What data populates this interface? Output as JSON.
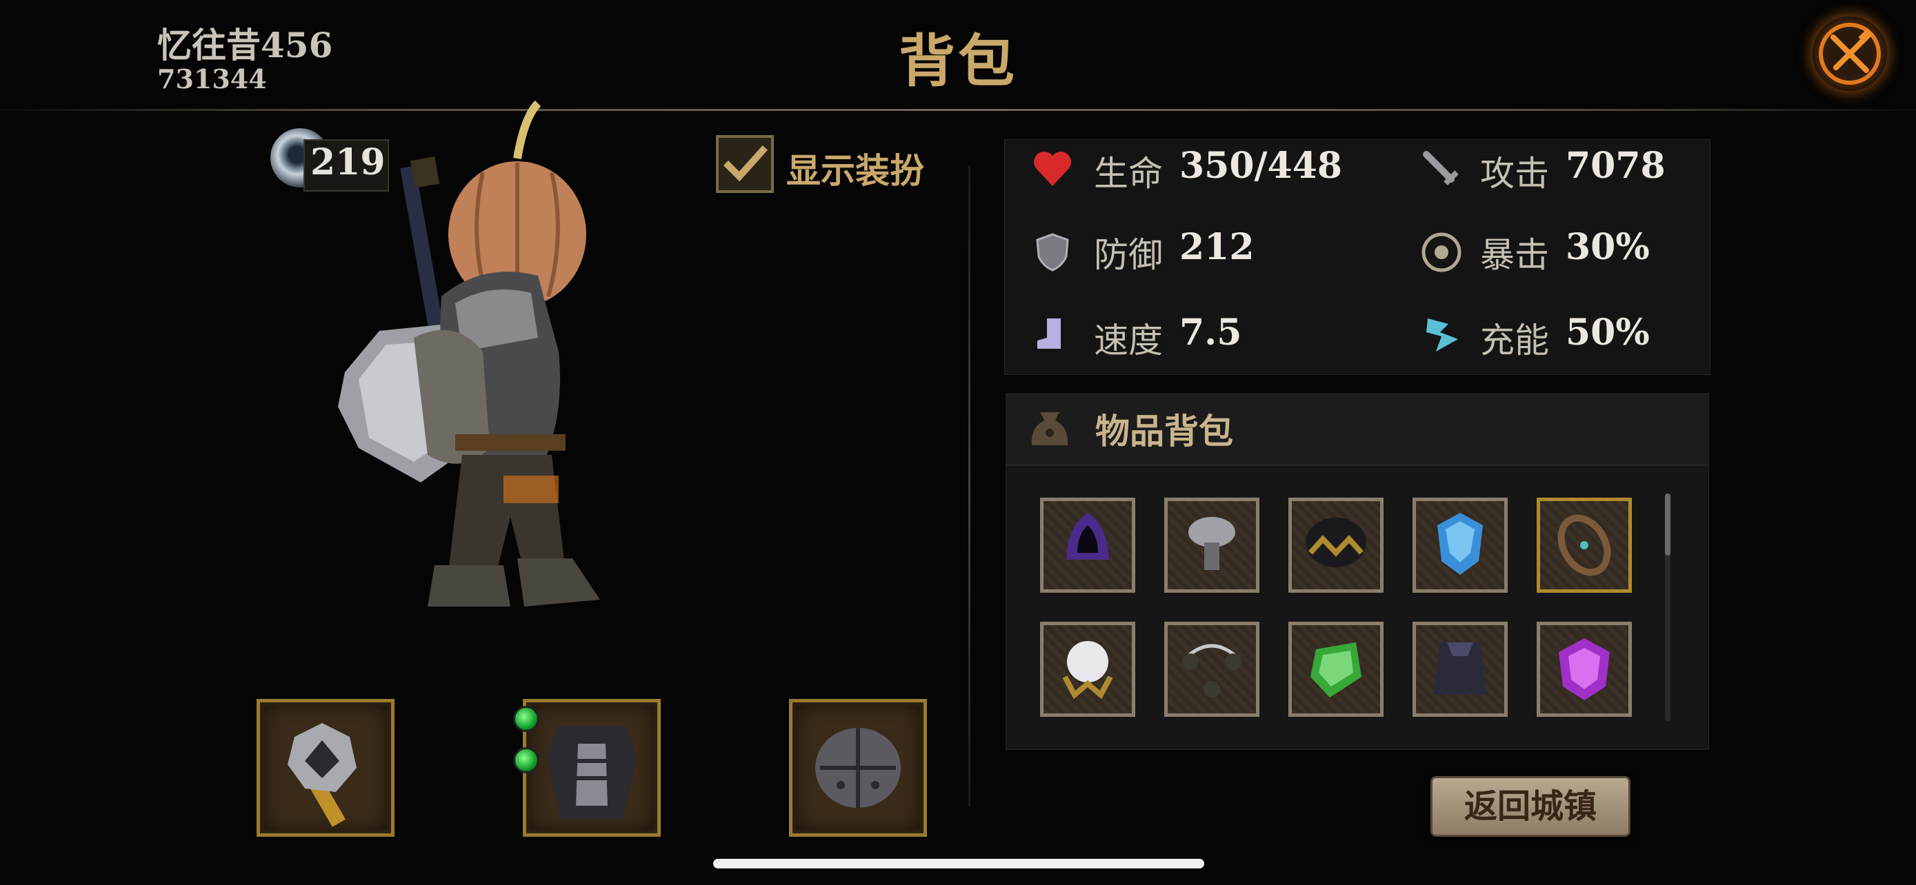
{
  "player": {
    "name": "忆往昔456",
    "id": "731344",
    "level": "219"
  },
  "title": "背包",
  "show_costume": {
    "label": "显示装扮",
    "checked": true
  },
  "stats": [
    {
      "icon": "heart-icon",
      "label": "生命",
      "value": "350/448"
    },
    {
      "icon": "sword-icon",
      "label": "攻击",
      "value": "7078"
    },
    {
      "icon": "shield-icon",
      "label": "防御",
      "value": "212"
    },
    {
      "icon": "crit-icon",
      "label": "暴击",
      "value": "30%"
    },
    {
      "icon": "boot-icon",
      "label": "速度",
      "value": "7.5"
    },
    {
      "icon": "energy-icon",
      "label": "充能",
      "value": "50%"
    }
  ],
  "bag": {
    "title": "物品背包",
    "items": [
      {
        "icon": "purple-hood-icon"
      },
      {
        "icon": "steel-gauntlet-icon"
      },
      {
        "icon": "dark-crown-icon"
      },
      {
        "icon": "blue-gem-icon"
      },
      {
        "icon": "chain-bracelet-icon"
      },
      {
        "icon": "pearl-amulet-icon"
      },
      {
        "icon": "morningstar-chain-icon"
      },
      {
        "icon": "green-gem-icon"
      },
      {
        "icon": "dark-cape-icon"
      },
      {
        "icon": "purple-gem-icon"
      }
    ]
  },
  "equipment": [
    {
      "icon": "mace-icon"
    },
    {
      "icon": "chest-armor-icon",
      "gems": 2
    },
    {
      "icon": "iron-helmet-icon"
    }
  ],
  "return_button": "返回城镇",
  "colors": {
    "accent_gold": "#c9a86a",
    "slot_border": "#9a7a2e",
    "close_glow": "#d26e14"
  }
}
